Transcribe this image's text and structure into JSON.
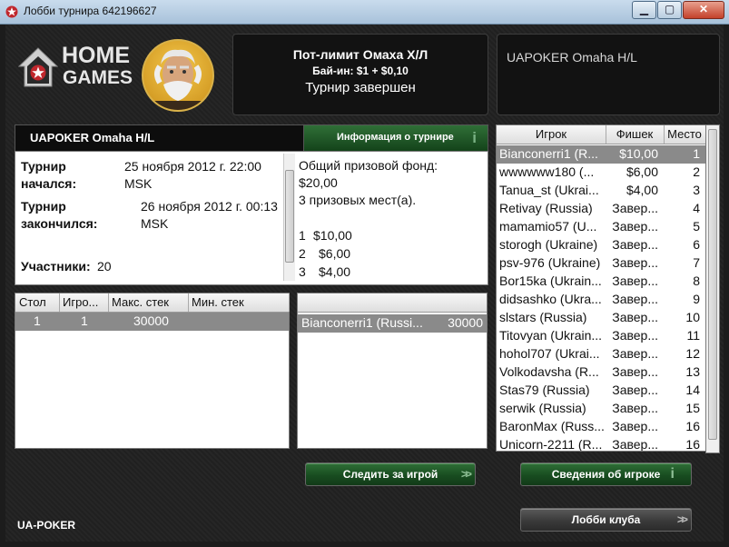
{
  "window": {
    "title": "Лобби турнира 642196627",
    "min": "▁",
    "max": "▢",
    "close": "✕"
  },
  "brand": {
    "line1": "HOME",
    "line2": "GAMES"
  },
  "game": {
    "name": "Пот-лимит Омаха Х/Л",
    "buyin": "Бай-ин: $1 + $0,10",
    "status": "Турнир завершен"
  },
  "club": {
    "name": "UAPOKER Omaha H/L"
  },
  "info": {
    "tab_left": "UAPOKER Omaha H/L",
    "tab_right": "Информация о турнире",
    "started_label": "Турнир начался:",
    "started_value": "25 ноября 2012 г. 22:00 MSK",
    "ended_label": "Турнир закончился:",
    "ended_value": "26 ноября 2012 г. 00:13 MSK",
    "participants_label": "Участники:",
    "participants_value": "20",
    "prize_pool_label": "Общий призовой фонд:",
    "prize_pool_value": "$20,00",
    "prize_places": "3 призовых мест(а).",
    "prizes": [
      {
        "place": "1",
        "amount": "$10,00"
      },
      {
        "place": "2",
        "amount": "$6,00"
      },
      {
        "place": "3",
        "amount": "$4,00"
      }
    ]
  },
  "tables": {
    "headers": [
      "Стол",
      "Игро...",
      "Макс. стек",
      "Мин. стек"
    ],
    "rows": [
      {
        "table": "1",
        "players": "1",
        "max": "30000",
        "min": ""
      }
    ]
  },
  "table_players": {
    "rows": [
      {
        "name": "Bianconerri1 (Russi...",
        "chips": "30000"
      }
    ]
  },
  "players": {
    "headers": [
      "Игрок",
      "Фишек",
      "Место"
    ],
    "rows": [
      {
        "name": "Bianconerri1 (R...",
        "chips": "$10,00",
        "place": "1"
      },
      {
        "name": "wwwwww180 (...",
        "chips": "$6,00",
        "place": "2"
      },
      {
        "name": "Tanua_st (Ukrai...",
        "chips": "$4,00",
        "place": "3"
      },
      {
        "name": "Retivay (Russia)",
        "chips": "Завер...",
        "place": "4"
      },
      {
        "name": "mamamio57 (U...",
        "chips": "Завер...",
        "place": "5"
      },
      {
        "name": "storogh (Ukraine)",
        "chips": "Завер...",
        "place": "6"
      },
      {
        "name": "psv-976 (Ukraine)",
        "chips": "Завер...",
        "place": "7"
      },
      {
        "name": "Bor15ka (Ukrain...",
        "chips": "Завер...",
        "place": "8"
      },
      {
        "name": "didsashko (Ukra...",
        "chips": "Завер...",
        "place": "9"
      },
      {
        "name": "slstars (Russia)",
        "chips": "Завер...",
        "place": "10"
      },
      {
        "name": "Titovyan (Ukrain...",
        "chips": "Завер...",
        "place": "11"
      },
      {
        "name": "hohol707 (Ukrai...",
        "chips": "Завер...",
        "place": "12"
      },
      {
        "name": "Volkodavsha (R...",
        "chips": "Завер...",
        "place": "13"
      },
      {
        "name": "Stas79 (Russia)",
        "chips": "Завер...",
        "place": "14"
      },
      {
        "name": "serwik (Russia)",
        "chips": "Завер...",
        "place": "15"
      },
      {
        "name": "BaronMax (Russ...",
        "chips": "Завер...",
        "place": "16"
      },
      {
        "name": "Unicorn-2211 (R...",
        "chips": "Завер...",
        "place": "16"
      }
    ]
  },
  "buttons": {
    "watch": "Следить за игрой",
    "player_info": "Сведения об игроке",
    "club_lobby": "Лобби клуба"
  },
  "footer": {
    "label": "UA-POKER"
  },
  "colors": {
    "accent_green": "#1f5a26",
    "selected_row": "#8a8a8a",
    "brand_red": "#c0272d"
  }
}
